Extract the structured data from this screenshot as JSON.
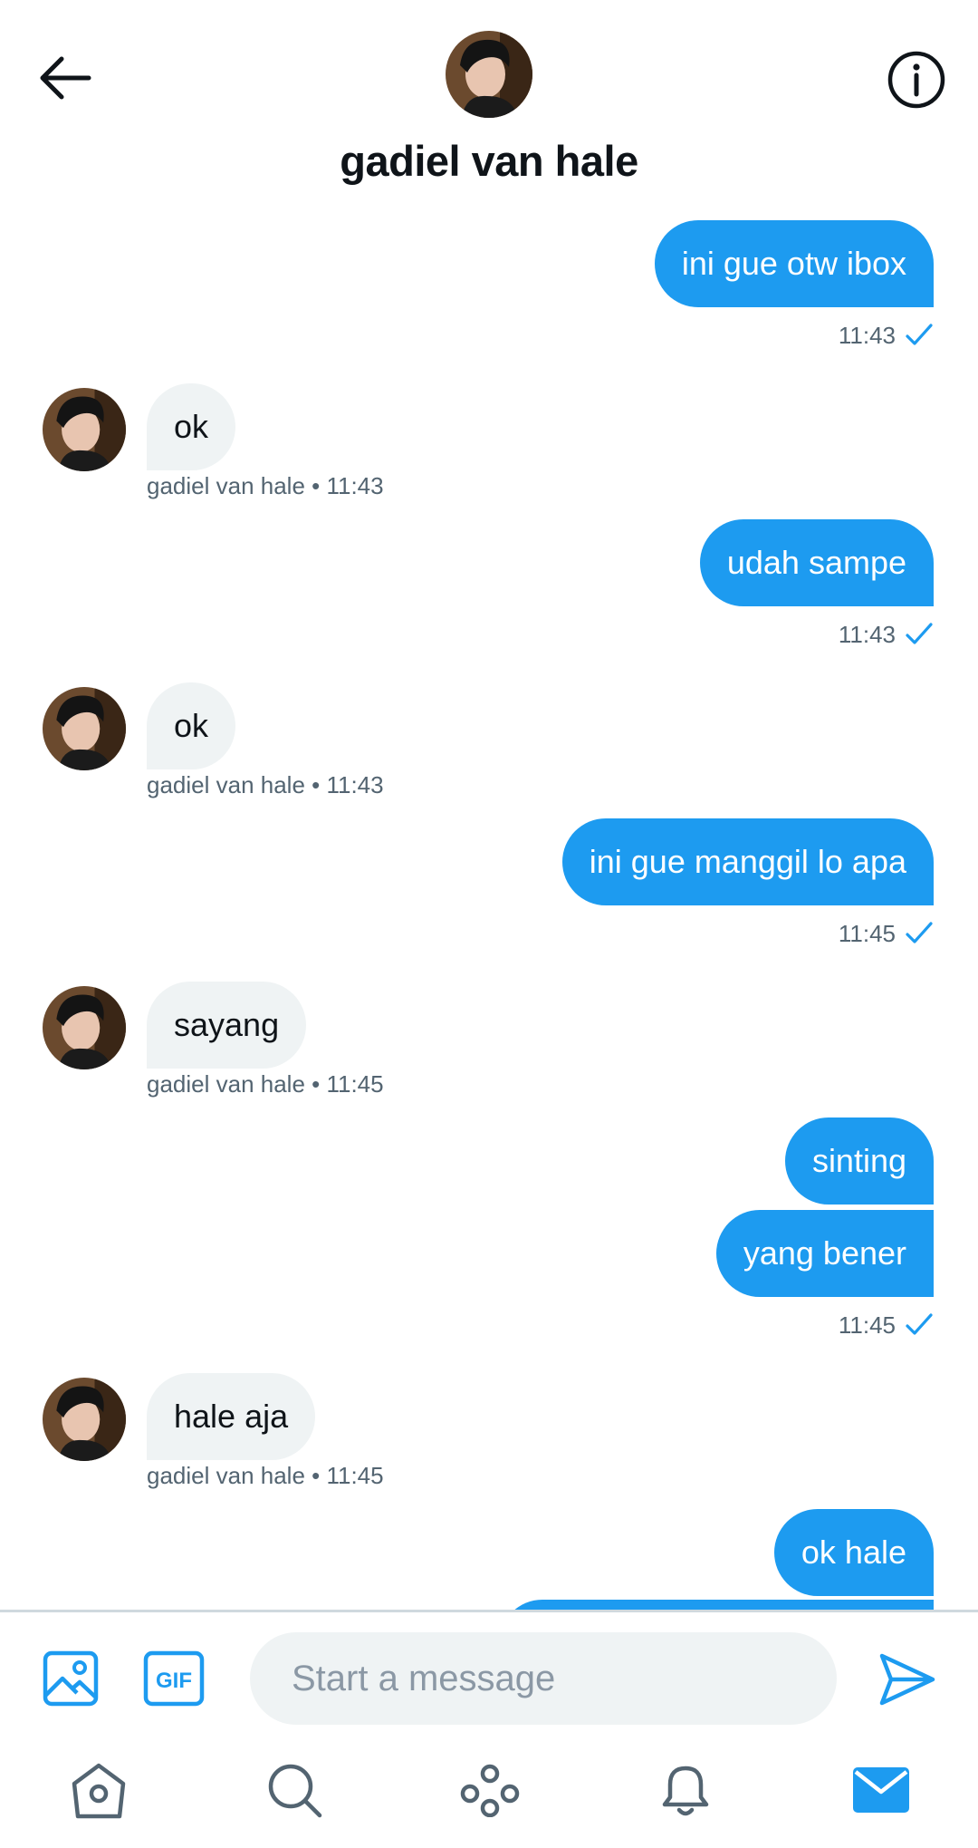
{
  "header": {
    "title": "gadiel van hale",
    "back_icon": "arrow-left-icon",
    "info_icon": "info-icon"
  },
  "contact": {
    "name": "gadiel van hale"
  },
  "messages": [
    {
      "dir": "out",
      "text": "ini gue otw ibox",
      "time": "11:43"
    },
    {
      "dir": "in",
      "text": "ok",
      "meta": "gadiel van hale • 11:43"
    },
    {
      "dir": "out",
      "text": "udah sampe",
      "time": "11:43"
    },
    {
      "dir": "in",
      "text": "ok",
      "meta": "gadiel van hale • 11:43"
    },
    {
      "dir": "out",
      "text": "ini gue manggil lo apa",
      "time": "11:45"
    },
    {
      "dir": "in",
      "text": "sayang",
      "meta": "gadiel van hale • 11:45"
    },
    {
      "dir": "out",
      "text": "sinting"
    },
    {
      "dir": "out",
      "text": "yang bener",
      "time": "11:45"
    },
    {
      "dir": "in",
      "text": "hale aja",
      "meta": "gadiel van hale • 11:45"
    },
    {
      "dir": "out",
      "text": "ok hale"
    }
  ],
  "composer": {
    "placeholder": "Start a message",
    "gif_label": "GIF"
  },
  "colors": {
    "accent": "#1d9bf0",
    "incoming_bubble": "#eff3f4",
    "meta_text": "#536471"
  },
  "nav": {
    "items": [
      "home-icon",
      "search-icon",
      "spaces-icon",
      "notifications-icon",
      "messages-icon"
    ],
    "active": "messages-icon"
  }
}
